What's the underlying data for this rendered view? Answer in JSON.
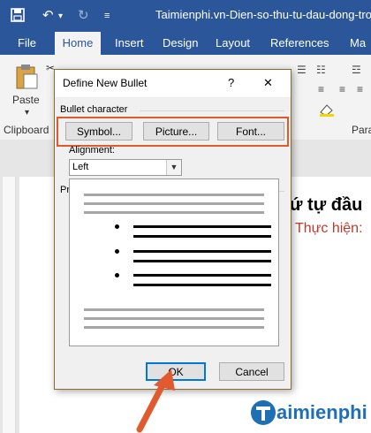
{
  "window": {
    "title": "Taimienphi.vn-Dien-so-thu-tu-dau-dong-tron"
  },
  "tabs": [
    {
      "label": "File"
    },
    {
      "label": "Home"
    },
    {
      "label": "Insert"
    },
    {
      "label": "Design"
    },
    {
      "label": "Layout"
    },
    {
      "label": "References"
    },
    {
      "label": "Ma"
    }
  ],
  "ribbon": {
    "paste_label": "Paste",
    "clipboard_label": "Clipboard",
    "para_label": "Para"
  },
  "document": {
    "heading_fragment": "ứ tự đầu",
    "subline_fragment": "Thực hiện:"
  },
  "dialog": {
    "title": "Define New Bullet",
    "help": "?",
    "close": "✕",
    "bullet_group_label": "Bullet character",
    "buttons": {
      "symbol": "Symbol...",
      "picture": "Picture...",
      "font": "Font..."
    },
    "alignment_label": "Alignment:",
    "alignment_value": "Left",
    "preview_label": "Preview",
    "ok": "OK",
    "cancel": "Cancel"
  },
  "watermark": {
    "text": "aimienphi"
  },
  "colors": {
    "word_blue": "#2b579a",
    "highlight": "#e05a2e",
    "subline": "#c0392b"
  }
}
